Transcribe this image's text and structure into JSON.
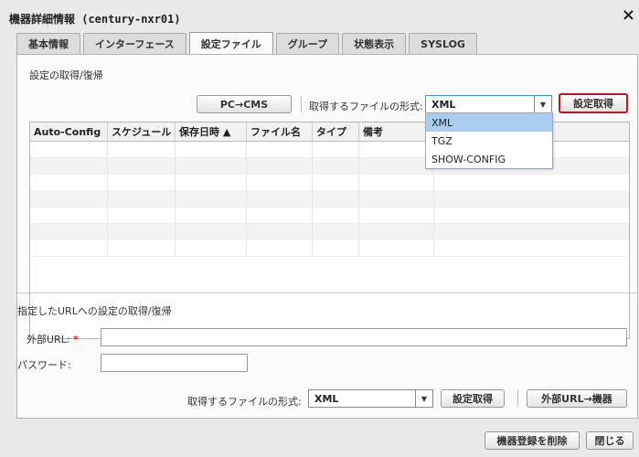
{
  "window": {
    "title": "機器詳細情報 (century-nxr01)",
    "close_glyph": "×"
  },
  "tabs": [
    {
      "label": "基本情報"
    },
    {
      "label": "インターフェース"
    },
    {
      "label": "設定ファイル",
      "active": true
    },
    {
      "label": "グループ"
    },
    {
      "label": "状態表示"
    },
    {
      "label": "SYSLOG"
    }
  ],
  "section1": {
    "title": "設定の取得/復帰",
    "pc_to_cms_label": "PC→CMS",
    "format_label": "取得するファイルの形式:",
    "format_value": "XML",
    "get_settings_label": "設定取得"
  },
  "table": {
    "columns": [
      "Auto-Config",
      "スケジュール",
      "保存日時 ▲",
      "ファイル名",
      "タイプ",
      "備考",
      ""
    ],
    "rows": [
      [],
      [],
      [],
      [],
      [],
      [],
      []
    ]
  },
  "dropdown": {
    "options": [
      "XML",
      "TGZ",
      "SHOW-CONFIG"
    ],
    "selected": "XML"
  },
  "section2": {
    "title": "指定したURLへの設定の取得/復帰",
    "url_label": "外部URL:",
    "required_mark": "*",
    "url_value": "",
    "password_label": "パスワード:",
    "password_value": "",
    "format_label": "取得するファイルの形式:",
    "format_value": "XML",
    "get_settings_label": "設定取得",
    "url_to_device_label": "外部URL→機器"
  },
  "footer": {
    "delete_label": "機器登録を削除",
    "close_label": "閉じる"
  },
  "icons": {
    "dropdown_arrow": "▼"
  },
  "colors": {
    "highlight_border": "#c0141e",
    "selected_option": "#a8cdf0",
    "required": "#dd2222"
  }
}
